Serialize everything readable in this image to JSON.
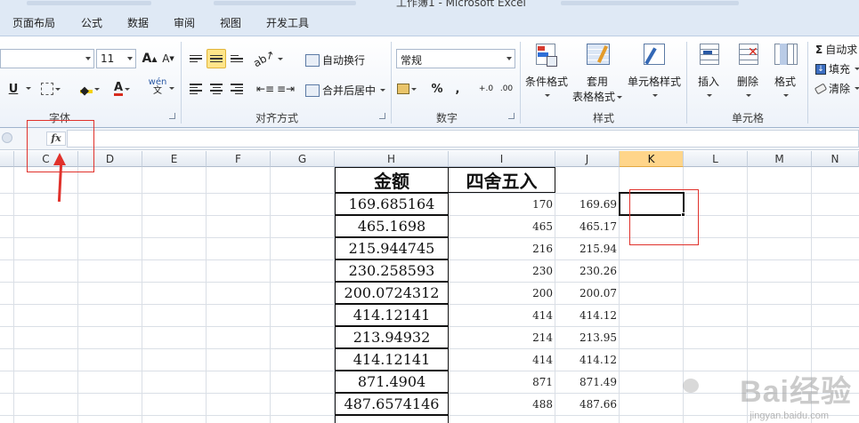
{
  "window": {
    "title": "工作簿1 - Microsoft Excel"
  },
  "ribbon_tabs": [
    "页面布局",
    "公式",
    "数据",
    "审阅",
    "视图",
    "开发工具"
  ],
  "font_group": {
    "label": "字体",
    "size_value": "11",
    "grow_label": "A",
    "shrink_label": "A",
    "underline_label": "U",
    "phonetic_label": "wén"
  },
  "align_group": {
    "label": "对齐方式",
    "wrap_label": "自动换行",
    "merge_label": "合并后居中"
  },
  "number_group": {
    "label": "数字",
    "format_value": "常规",
    "percent_label": "%",
    "comma_label": ",",
    "inc_decimal_label": "+.0",
    "dec_decimal_label": ".00"
  },
  "styles_group": {
    "label": "样式",
    "conditional_label": "条件格式",
    "table_format_label_1": "套用",
    "table_format_label_2": "表格格式",
    "cell_styles_label": "单元格样式"
  },
  "cells_group": {
    "label": "单元格",
    "insert_label": "插入",
    "delete_label": "删除",
    "format_label": "格式"
  },
  "editing_group": {
    "autosum_label": "自动求",
    "fill_label": "填充",
    "clear_label": "清除",
    "sigma": "Σ"
  },
  "formula_bar": {
    "fx_label": "fx",
    "value": ""
  },
  "columns": [
    "C",
    "D",
    "E",
    "F",
    "G",
    "H",
    "I",
    "J",
    "K",
    "L",
    "M",
    "N"
  ],
  "selected_column": "K",
  "table": {
    "header_h": "金额",
    "header_i": "四舍五入",
    "rows": [
      {
        "h": "169.685164",
        "i": "170",
        "j": "169.69"
      },
      {
        "h": "465.1698",
        "i": "465",
        "j": "465.17"
      },
      {
        "h": "215.944745",
        "i": "216",
        "j": "215.94"
      },
      {
        "h": "230.258593",
        "i": "230",
        "j": "230.26"
      },
      {
        "h": "200.0724312",
        "i": "200",
        "j": "200.07"
      },
      {
        "h": "414.12141",
        "i": "414",
        "j": "414.12"
      },
      {
        "h": "213.94932",
        "i": "214",
        "j": "213.95"
      },
      {
        "h": "414.12141",
        "i": "414",
        "j": "414.12"
      },
      {
        "h": "871.4904",
        "i": "871",
        "j": "871.49"
      },
      {
        "h": "487.6574146",
        "i": "488",
        "j": "487.66"
      }
    ]
  },
  "watermark": {
    "brand": "Bai经验",
    "site": "jingyan.baidu.com"
  },
  "colors": {
    "ribbon_bg": "#dfe9f5",
    "selected_header": "#ffd58a",
    "annotation_red": "#e0312b",
    "grid_line": "#dadfe6"
  }
}
